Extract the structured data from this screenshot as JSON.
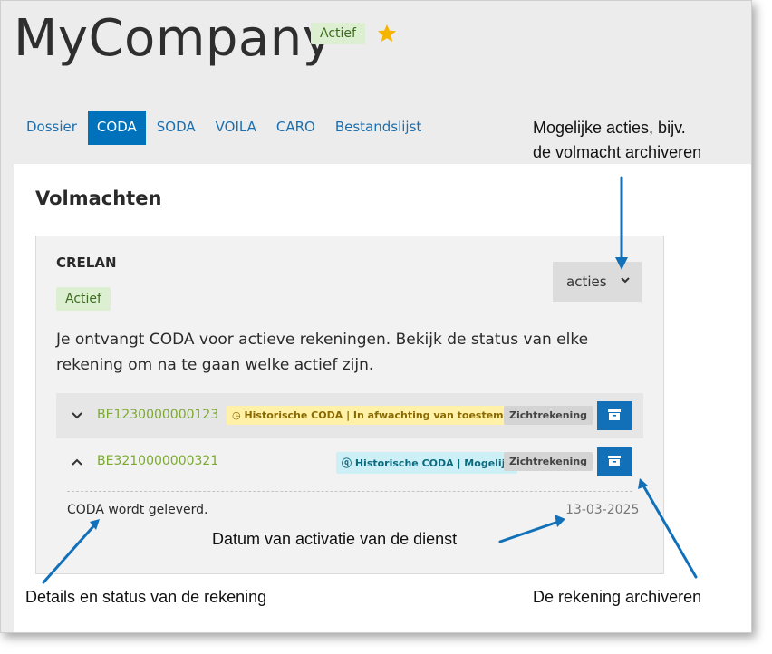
{
  "header": {
    "title": "MyCompany",
    "status_badge": "Actief"
  },
  "tabs": [
    {
      "label": "Dossier",
      "active": false
    },
    {
      "label": "CODA",
      "active": true
    },
    {
      "label": "SODA",
      "active": false
    },
    {
      "label": "VOILA",
      "active": false
    },
    {
      "label": "CARO",
      "active": false
    },
    {
      "label": "Bestandslijst",
      "active": false
    }
  ],
  "section": {
    "title": "Volmachten",
    "card": {
      "bank": "CRELAN",
      "status_badge": "Actief",
      "actions_label": "acties",
      "description": "Je ontvangt CODA voor actieve rekeningen. Bekijk de status van elke rekening om na te gaan welke actief zijn.",
      "accounts": [
        {
          "iban": "BE1230000000123",
          "status_tag": "Historische CODA | In afwachting van toestemming",
          "type_tag": "Zichtrekening",
          "expanded": false
        },
        {
          "iban": "BE3210000000321",
          "status_tag": "Historische CODA | Mogelijk",
          "type_tag": "Zichtrekening",
          "expanded": true
        }
      ],
      "detail_text": "CODA wordt geleverd.",
      "detail_date": "13-03-2025"
    }
  },
  "annotations": {
    "actions_line1": "Mogelijke acties, bijv.",
    "actions_line2": "de volmacht archiveren",
    "date_note": "Datum van activatie van de dienst",
    "details_note": "Details en status van de rekening",
    "archive_note": "De rekening archiveren"
  },
  "colors": {
    "accent_blue": "#0072bb",
    "active_green_bg": "#dcefd0",
    "star": "#f5b400",
    "iban_green": "#7caa31",
    "arrow_blue": "#1170b8"
  }
}
